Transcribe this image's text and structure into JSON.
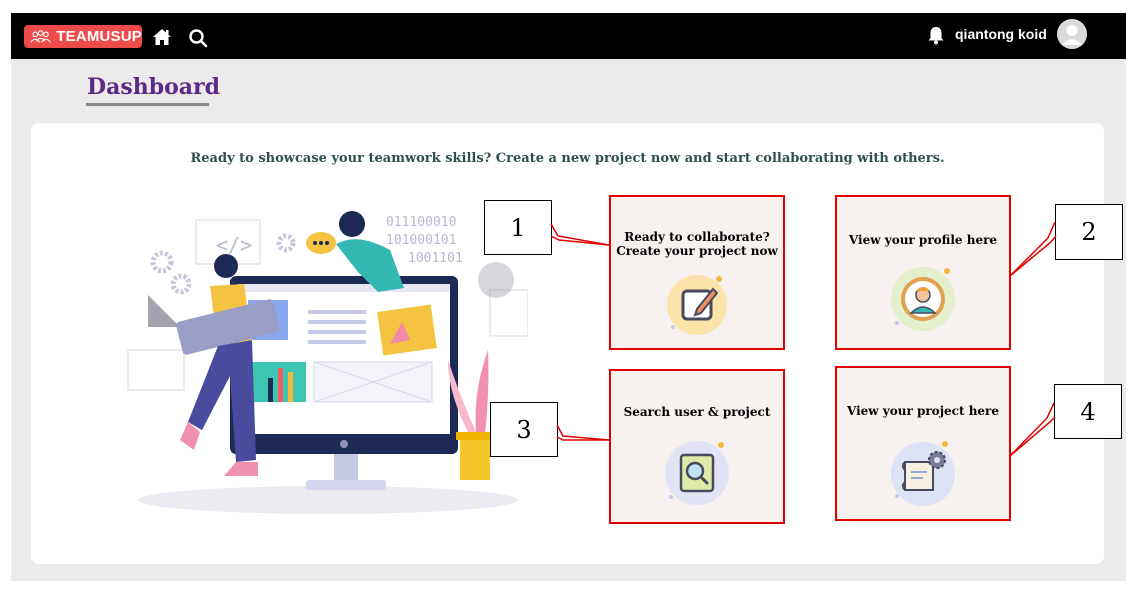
{
  "nav": {
    "logo_text": "TEAMUSUP",
    "username": "qiantong koid",
    "icons": [
      "home-icon",
      "search-icon",
      "bell-icon",
      "user-avatar-icon"
    ]
  },
  "page": {
    "title": "Dashboard",
    "intro": "Ready to showcase your teamwork skills? Create a new project now and start collaborating with others."
  },
  "illustration": {
    "binary_lines": [
      "011100010",
      "101000101",
      "1001101"
    ]
  },
  "cards": [
    {
      "label_line1": "Ready to collaborate?",
      "label_line2": "Create your project now",
      "icon": "edit-icon"
    },
    {
      "label_line1": "View your profile here",
      "icon": "profile-icon"
    },
    {
      "label_line1": "Search user & project",
      "icon": "magnifier-icon"
    },
    {
      "label_line1": "View your project here",
      "icon": "blueprint-gear-icon"
    }
  ],
  "callouts": [
    "1",
    "2",
    "3",
    "4"
  ],
  "colors": {
    "topbar": "#000000",
    "logo_bg": "#ee4b4b",
    "title": "#5b2a86",
    "card_bg": "#f7f1ef",
    "highlight_border": "#e00000"
  }
}
